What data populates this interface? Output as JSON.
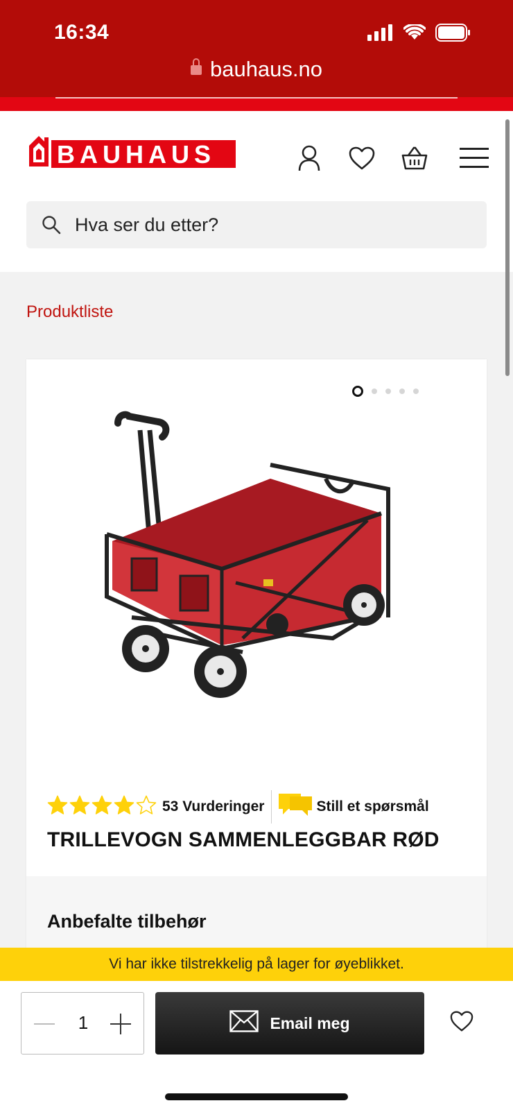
{
  "status_bar": {
    "time": "16:34",
    "url": "bauhaus.no"
  },
  "header": {
    "logo_text": "BAUHAUS",
    "search_placeholder": "Hva ser du etter?",
    "icons": [
      "user-icon",
      "heart-icon",
      "basket-icon",
      "menu-icon"
    ]
  },
  "breadcrumb": "Produktliste",
  "product": {
    "image_count": 5,
    "active_image": 1,
    "rating": 4,
    "rating_max": 5,
    "reviews_label": "53 Vurderinger",
    "question_label": "Still et spørsmål",
    "title": "TRILLEVOGN SAMMENLEGGBAR RØD",
    "accessories_title": "Anbefalte tilbehør"
  },
  "stock_notice": "Vi har ikke tilstrekkelig på lager for øyeblikket.",
  "purchase": {
    "quantity": "1",
    "email_label": "Email meg"
  },
  "colors": {
    "brand_red": "#e30613",
    "statusbar_red": "#b30c08",
    "star_yellow": "#fed10a",
    "stock_banner": "#fed10a"
  }
}
